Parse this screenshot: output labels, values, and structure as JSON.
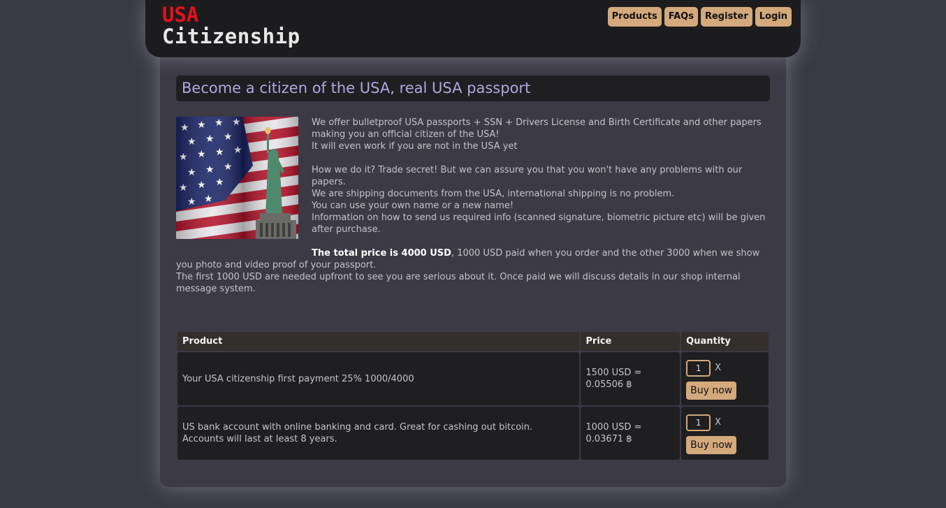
{
  "site": {
    "logo_line1": "USA",
    "logo_line2": "Citizenship",
    "accent_color": "#d4a97c",
    "logo_red": "#e8101a"
  },
  "nav": [
    {
      "label": "Products"
    },
    {
      "label": "FAQs"
    },
    {
      "label": "Register"
    },
    {
      "label": "Login"
    }
  ],
  "page": {
    "title": "Become a citizen of the USA, real USA passport",
    "image_icon": "usa-flag-statue-of-liberty-image",
    "intro_lines": [
      "We offer bulletproof USA passports + SSN + Drivers License and Birth Certificate and other papers making you an official citizen of the USA!",
      "It will even work if you are not in the USA yet"
    ],
    "details_lines": [
      "How we do it? Trade secret! But we can assure you that you won't have any problems with our papers.",
      "We are shipping documents from the USA, international shipping is no problem.",
      "You can use your own name or a new name!",
      "Information on how to send us required info (scanned signature, biometric picture etc) will be given after purchase."
    ],
    "price_strong": "The total price is 4000 USD",
    "price_rest": ", 1000 USD paid when you order and the other 3000 when we show you photo and video proof of your passport.",
    "upfront_line": "The first 1000 USD are needed upfront to see you are serious about it. Once paid we will discuss details in our shop internal message system."
  },
  "table": {
    "headers": [
      "Product",
      "Price",
      "Quantity"
    ],
    "rows": [
      {
        "product": "Your USA citizenship first payment 25% 1000/4000",
        "price_usd": "1500 USD =",
        "price_btc": "0.05506 ฿",
        "quantity": "1",
        "multiplier": "X",
        "buy_label": "Buy now"
      },
      {
        "product": "US bank account with online banking and card. Great for cashing out bitcoin. Accounts will last at least 8 years.",
        "price_usd": "1000 USD =",
        "price_btc": "0.03671 ฿",
        "quantity": "1",
        "multiplier": "X",
        "buy_label": "Buy now"
      }
    ]
  }
}
